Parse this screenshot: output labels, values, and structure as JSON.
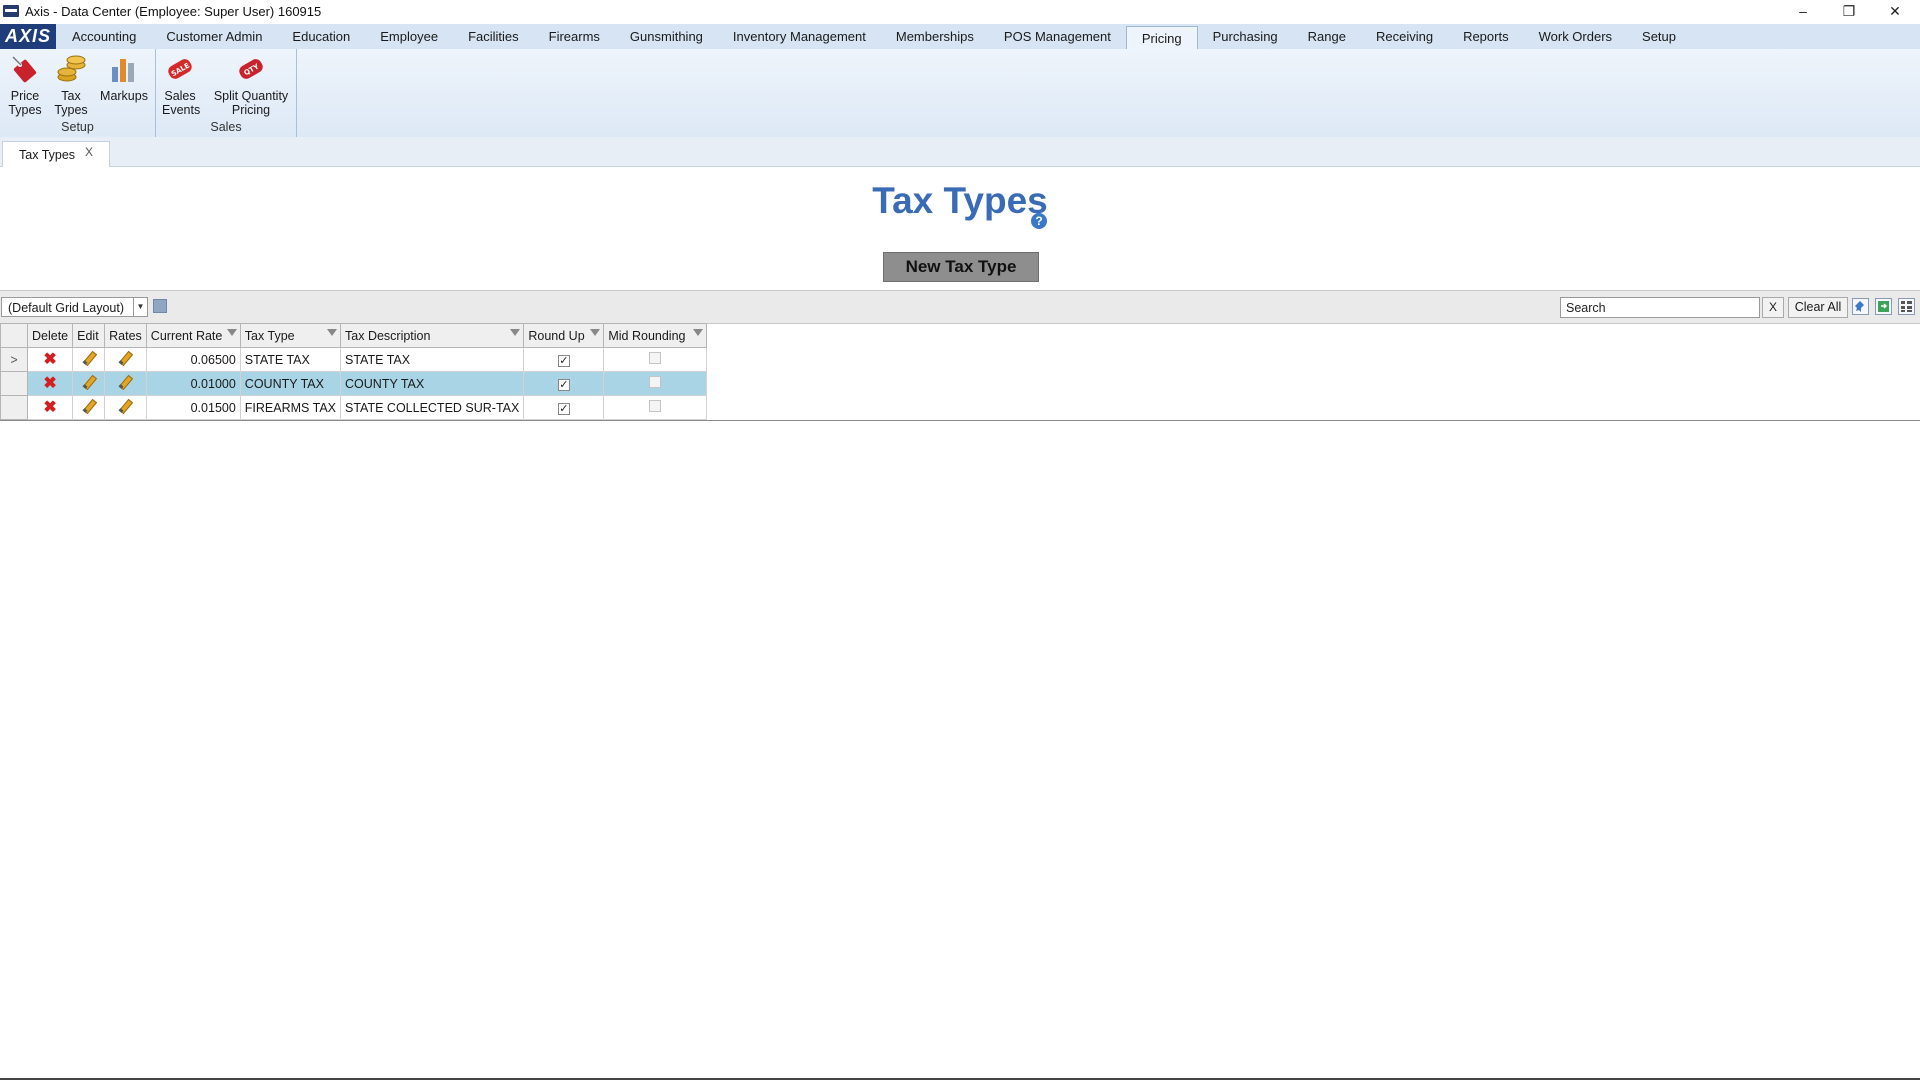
{
  "window": {
    "title": "Axis - Data Center  (Employee: Super User) 160915",
    "minimize": "–",
    "restore": "❐",
    "close": "✕"
  },
  "logo": "AXIS",
  "menu": [
    "Accounting",
    "Customer Admin",
    "Education",
    "Employee",
    "Facilities",
    "Firearms",
    "Gunsmithing",
    "Inventory Management",
    "Memberships",
    "POS Management",
    "Pricing",
    "Purchasing",
    "Range",
    "Receiving",
    "Reports",
    "Work Orders",
    "Setup"
  ],
  "menu_active": "Pricing",
  "ribbon": {
    "setup_group": "Setup",
    "sales_group": "Sales",
    "price_types": [
      "Price",
      "Types"
    ],
    "tax_types": [
      "Tax",
      "Types"
    ],
    "markups": "Markups",
    "sales_events": [
      "Sales",
      "Events"
    ],
    "split_qty": [
      "Split Quantity",
      "Pricing"
    ],
    "sale_badge": "SALE",
    "qty_badge": "QTY"
  },
  "doc_tab": {
    "label": "Tax Types",
    "close": "X"
  },
  "page": {
    "title": "Tax Types",
    "help": "?",
    "new_button": "New Tax Type"
  },
  "toolbar": {
    "layout": "(Default Grid Layout)",
    "search_placeholder": "Search",
    "search_clear": "X",
    "clear_all": "Clear All"
  },
  "grid": {
    "columns": [
      "Delete",
      "Edit",
      "Rates",
      "Current Rate",
      "Tax Type",
      "Tax Description",
      "Round Up",
      "Mid Rounding"
    ],
    "row_indicator": ">",
    "rows": [
      {
        "rate": "0.06500",
        "type": "STATE TAX",
        "desc": "STATE TAX",
        "round_up": true,
        "mid": false
      },
      {
        "rate": "0.01000",
        "type": "COUNTY TAX",
        "desc": "COUNTY TAX",
        "round_up": true,
        "mid": false
      },
      {
        "rate": "0.01500",
        "type": "FIREARMS TAX",
        "desc": "STATE COLLECTED SUR-TAX",
        "round_up": true,
        "mid": false
      }
    ],
    "highlighted_row": 1,
    "current_row": 0
  },
  "colors": {
    "accent": "#3a6bb5",
    "highlight": "#a8d4e6",
    "menubar": "#d6e4f3",
    "delete": "#d21f1f"
  }
}
